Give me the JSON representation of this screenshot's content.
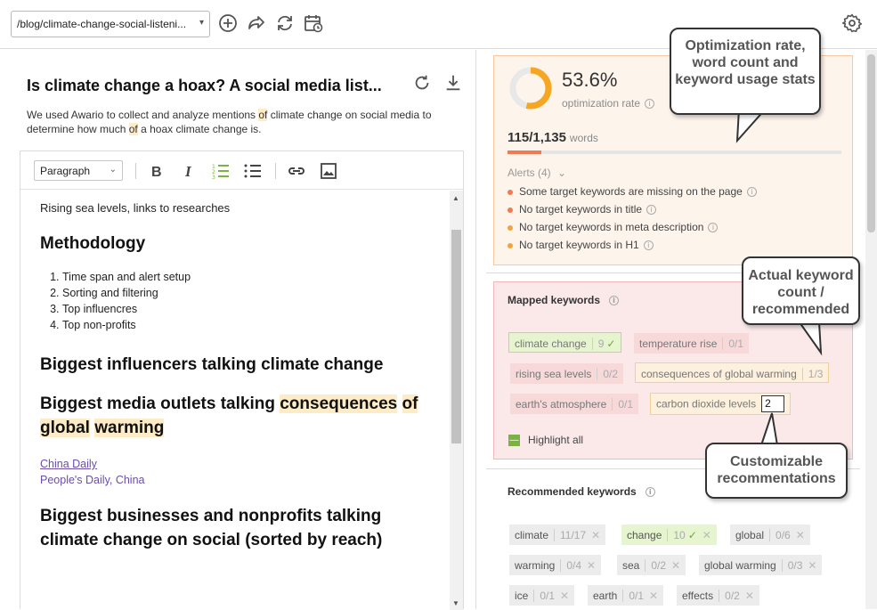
{
  "topbar": {
    "url": "/blog/climate-change-social-listeni...",
    "icons": [
      "add-icon",
      "share-icon",
      "refresh-icon",
      "schedule-icon",
      "settings-icon"
    ]
  },
  "document": {
    "title": "Is climate change a hoax? A social media list...",
    "desc_parts": [
      "We used Awario to collect and analyze mentions ",
      "of",
      " climate change on social media to determine how much ",
      "of",
      " a hoax climate change is."
    ]
  },
  "editor": {
    "format": "Paragraph",
    "content": {
      "line1": "Rising sea levels, links to researches",
      "h_methodology": "Methodology",
      "steps": [
        "Time span and alert setup",
        "Sorting and filtering",
        "Top influencres",
        "Top non-profits"
      ],
      "h_influencers": "Biggest influencers talking climate change",
      "h_media_prefix": "Biggest media outlets talking ",
      "h_media_hl1": "consequences",
      "h_media_hl2": "of",
      "h_media_hl3": "global",
      "h_media_hl4": "warming",
      "link1": "China Daily",
      "link2": "People's Daily, China",
      "h_business": "Biggest businesses and nonprofits talking climate change on social (sorted by reach)"
    }
  },
  "stats": {
    "optimization_rate": "53.6%",
    "optimization_rate_value": 0.536,
    "optimization_label": "optimization rate",
    "word_count": "115",
    "word_target": "1,135",
    "words_label": "words",
    "word_progress": 0.101,
    "alerts_header": "Alerts (4)",
    "alerts": [
      {
        "text": "Some target keywords are missing on the page",
        "color": "#f07a52"
      },
      {
        "text": "No target keywords in title",
        "color": "#f07a52"
      },
      {
        "text": "No target keywords in meta description",
        "color": "#f0a53c"
      },
      {
        "text": "No target keywords in H1",
        "color": "#f0a53c"
      }
    ]
  },
  "mapped": {
    "title": "Mapped keywords",
    "keywords": [
      {
        "name": "climate change",
        "count": "9"
      },
      {
        "name": "temperature rise",
        "count": "0/1"
      },
      {
        "name": "rising sea levels",
        "count": "0/2"
      },
      {
        "name": "consequences of global warming",
        "count": "1/3"
      },
      {
        "name": "earth's atmosphere",
        "count": "0/1"
      },
      {
        "name": "carbon dioxide levels",
        "count": "2"
      }
    ],
    "highlight_all": "Highlight all"
  },
  "recommended": {
    "title": "Recommended keywords",
    "keywords": [
      {
        "name": "climate",
        "count": "11/17"
      },
      {
        "name": "change",
        "count": "10"
      },
      {
        "name": "global",
        "count": "0/6"
      },
      {
        "name": "warming",
        "count": "0/4"
      },
      {
        "name": "sea",
        "count": "0/2"
      },
      {
        "name": "global warming",
        "count": "0/3"
      },
      {
        "name": "ice",
        "count": "0/1"
      },
      {
        "name": "earth",
        "count": "0/1"
      },
      {
        "name": "effects",
        "count": "0/2"
      }
    ]
  },
  "callouts": {
    "stats": "Optimization rate, word count and keyword usage stats",
    "count": "Actual keyword count / recommended",
    "custom": "Customizable recommentations"
  }
}
